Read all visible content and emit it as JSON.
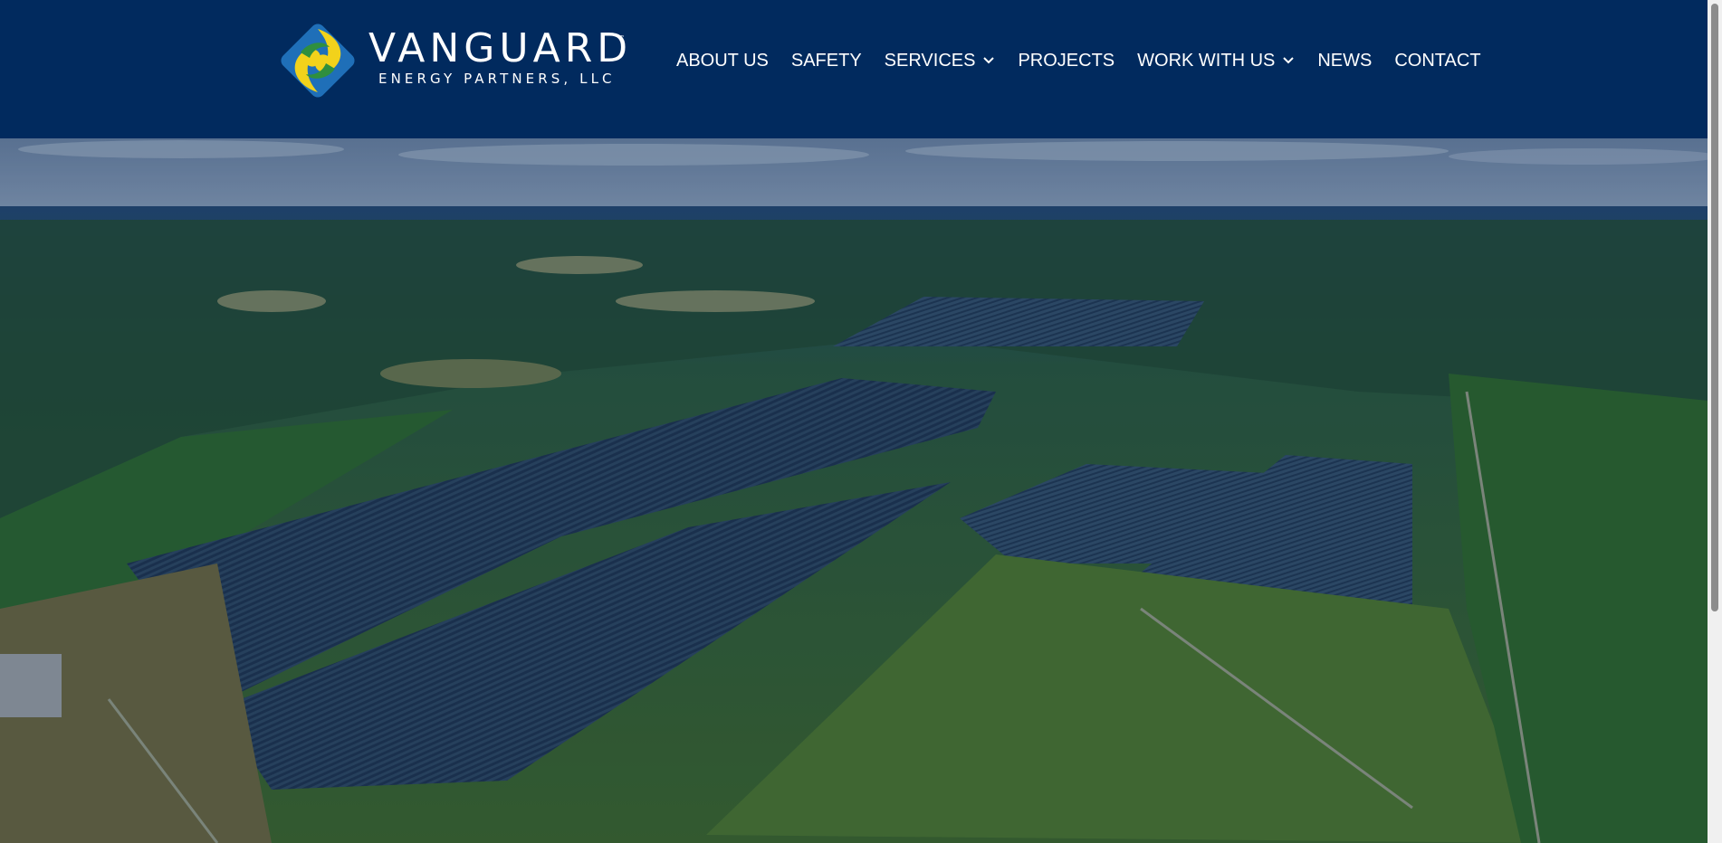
{
  "brand": {
    "name": "VANGUARD",
    "trademark": "™",
    "tagline": "ENERGY PARTNERS, LLC"
  },
  "nav": {
    "items": [
      {
        "label": "ABOUT US",
        "has_dropdown": false
      },
      {
        "label": "SAFETY",
        "has_dropdown": false
      },
      {
        "label": "SERVICES",
        "has_dropdown": true
      },
      {
        "label": "PROJECTS",
        "has_dropdown": false
      },
      {
        "label": "WORK WITH US",
        "has_dropdown": true
      },
      {
        "label": "NEWS",
        "has_dropdown": false
      },
      {
        "label": "CONTACT",
        "has_dropdown": false
      }
    ],
    "dropdown_icon": "chevron-down-icon"
  },
  "hero": {
    "image_subject": "aerial view of a utility-scale solar farm surrounded by forest"
  },
  "colors": {
    "header_bg": "#012a5e",
    "logo_blue": "#1f6fb8",
    "logo_yellow": "#f2d21b",
    "logo_green": "#2f8f3e",
    "nav_text": "#ffffff"
  }
}
